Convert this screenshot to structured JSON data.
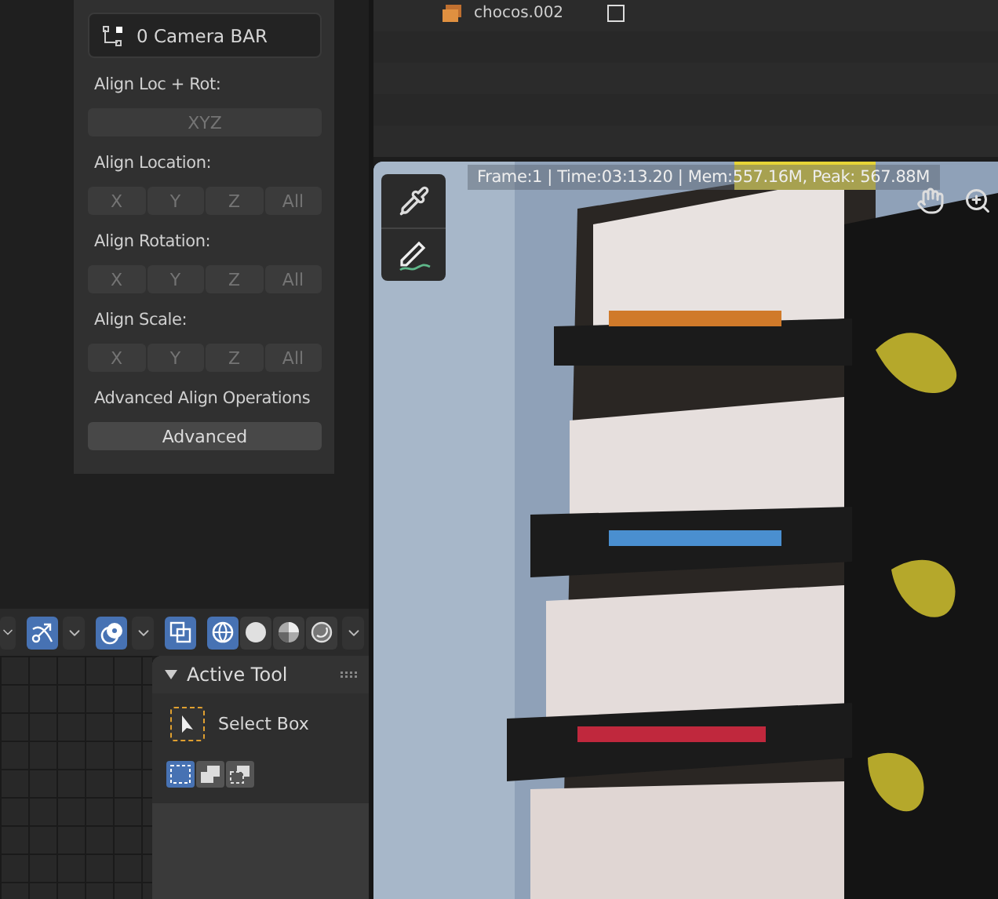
{
  "outliner": {
    "rows": [
      {
        "label": "chocos.002",
        "checked": false
      }
    ]
  },
  "align_panel": {
    "object": "0 Camera BAR",
    "sections": [
      {
        "label": "Align Loc + Rot:",
        "disabled": true,
        "buttons": [
          "XYZ"
        ]
      },
      {
        "label": "Align Location:",
        "disabled": true,
        "buttons": [
          "X",
          "Y",
          "Z",
          "All"
        ]
      },
      {
        "label": "Align Rotation:",
        "disabled": true,
        "buttons": [
          "X",
          "Y",
          "Z",
          "All"
        ]
      },
      {
        "label": "Align Scale:",
        "disabled": true,
        "buttons": [
          "X",
          "Y",
          "Z",
          "All"
        ]
      },
      {
        "label": "Advanced Align Operations",
        "disabled": false,
        "buttons": [
          "Advanced"
        ]
      }
    ]
  },
  "header": {
    "toggles": [
      {
        "kind": "curves",
        "on": true
      },
      {
        "kind": "overlay",
        "on": true
      },
      {
        "kind": "xray",
        "on": true
      }
    ],
    "shading": [
      {
        "kind": "wireframe",
        "selected": true
      },
      {
        "kind": "solid",
        "selected": false
      },
      {
        "kind": "material",
        "selected": false
      },
      {
        "kind": "rendered",
        "selected": false
      }
    ]
  },
  "active_tool": {
    "title": "Active Tool",
    "expanded": true,
    "tool": "Select Box",
    "modes": [
      {
        "kind": "new",
        "selected": true
      },
      {
        "kind": "extend",
        "selected": false
      },
      {
        "kind": "subtract",
        "selected": false
      }
    ]
  },
  "render_view": {
    "info": "Frame:1 | Time:03:13.20 | Mem:557.16M, Peak: 567.88M",
    "tools": [
      {
        "kind": "eyedropper"
      },
      {
        "kind": "annotate"
      }
    ]
  }
}
